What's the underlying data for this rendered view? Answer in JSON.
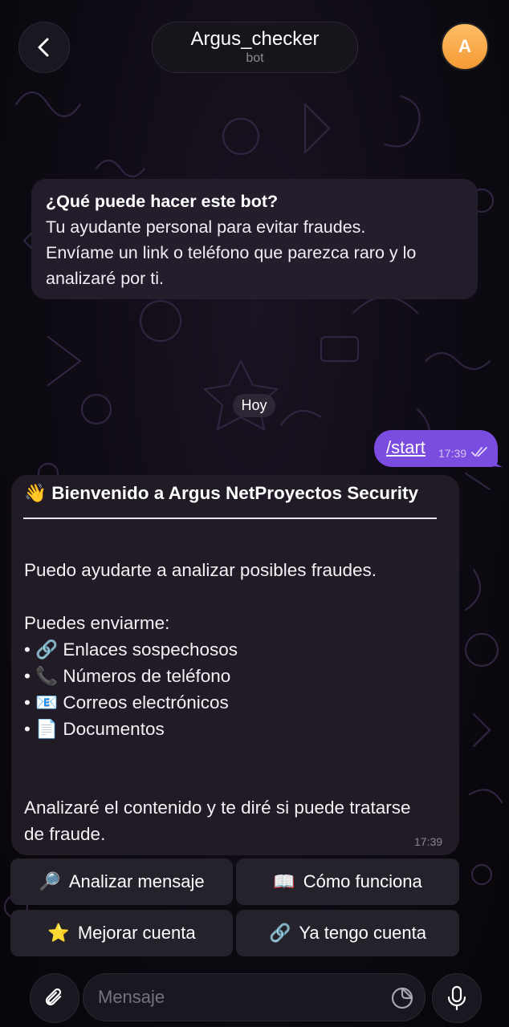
{
  "header": {
    "back_icon": "chevron-left-icon",
    "title": "Argus_checker",
    "subtitle": "bot",
    "avatar_letter": "A",
    "avatar_color": "#f7a844"
  },
  "info_card": {
    "question": "¿Qué puede hacer este bot?",
    "lines": [
      "Tu ayudante personal para evitar fraudes.",
      "Envíame un link o teléfono que parezca raro y lo",
      "analizaré por ti."
    ]
  },
  "date_chip": "Hoy",
  "outgoing": {
    "text": "/start",
    "time": "17:39",
    "status_icon": "double-check-icon",
    "color": "#7a4ce0"
  },
  "bot_message": {
    "heading": "👋 Bienvenido a Argus NetProyectos Security",
    "intro": "Puedo ayudarte a analizar posibles fraudes.",
    "list_title": "Puedes enviarme:",
    "items": [
      "• 🔗 Enlaces sospechosos",
      "• 📞 Números de teléfono",
      "• 📧 Correos electrónicos",
      "• 📄 Documentos"
    ],
    "outro_1": "Analizaré el contenido y te diré si puede tratarse",
    "outro_2": "de fraude.",
    "time": "17:39"
  },
  "keyboard": {
    "analyze": {
      "emoji": "🔎",
      "label": "Analizar mensaje"
    },
    "how": {
      "emoji": "📖",
      "label": "Cómo funciona"
    },
    "upgrade": {
      "emoji": "⭐",
      "label": "Mejorar cuenta"
    },
    "have_account": {
      "emoji": "🔗",
      "label": "Ya tengo cuenta"
    }
  },
  "composer": {
    "placeholder": "Mensaje",
    "attach_icon": "paperclip-icon",
    "sticker_icon": "sticker-icon",
    "mic_icon": "microphone-icon"
  }
}
